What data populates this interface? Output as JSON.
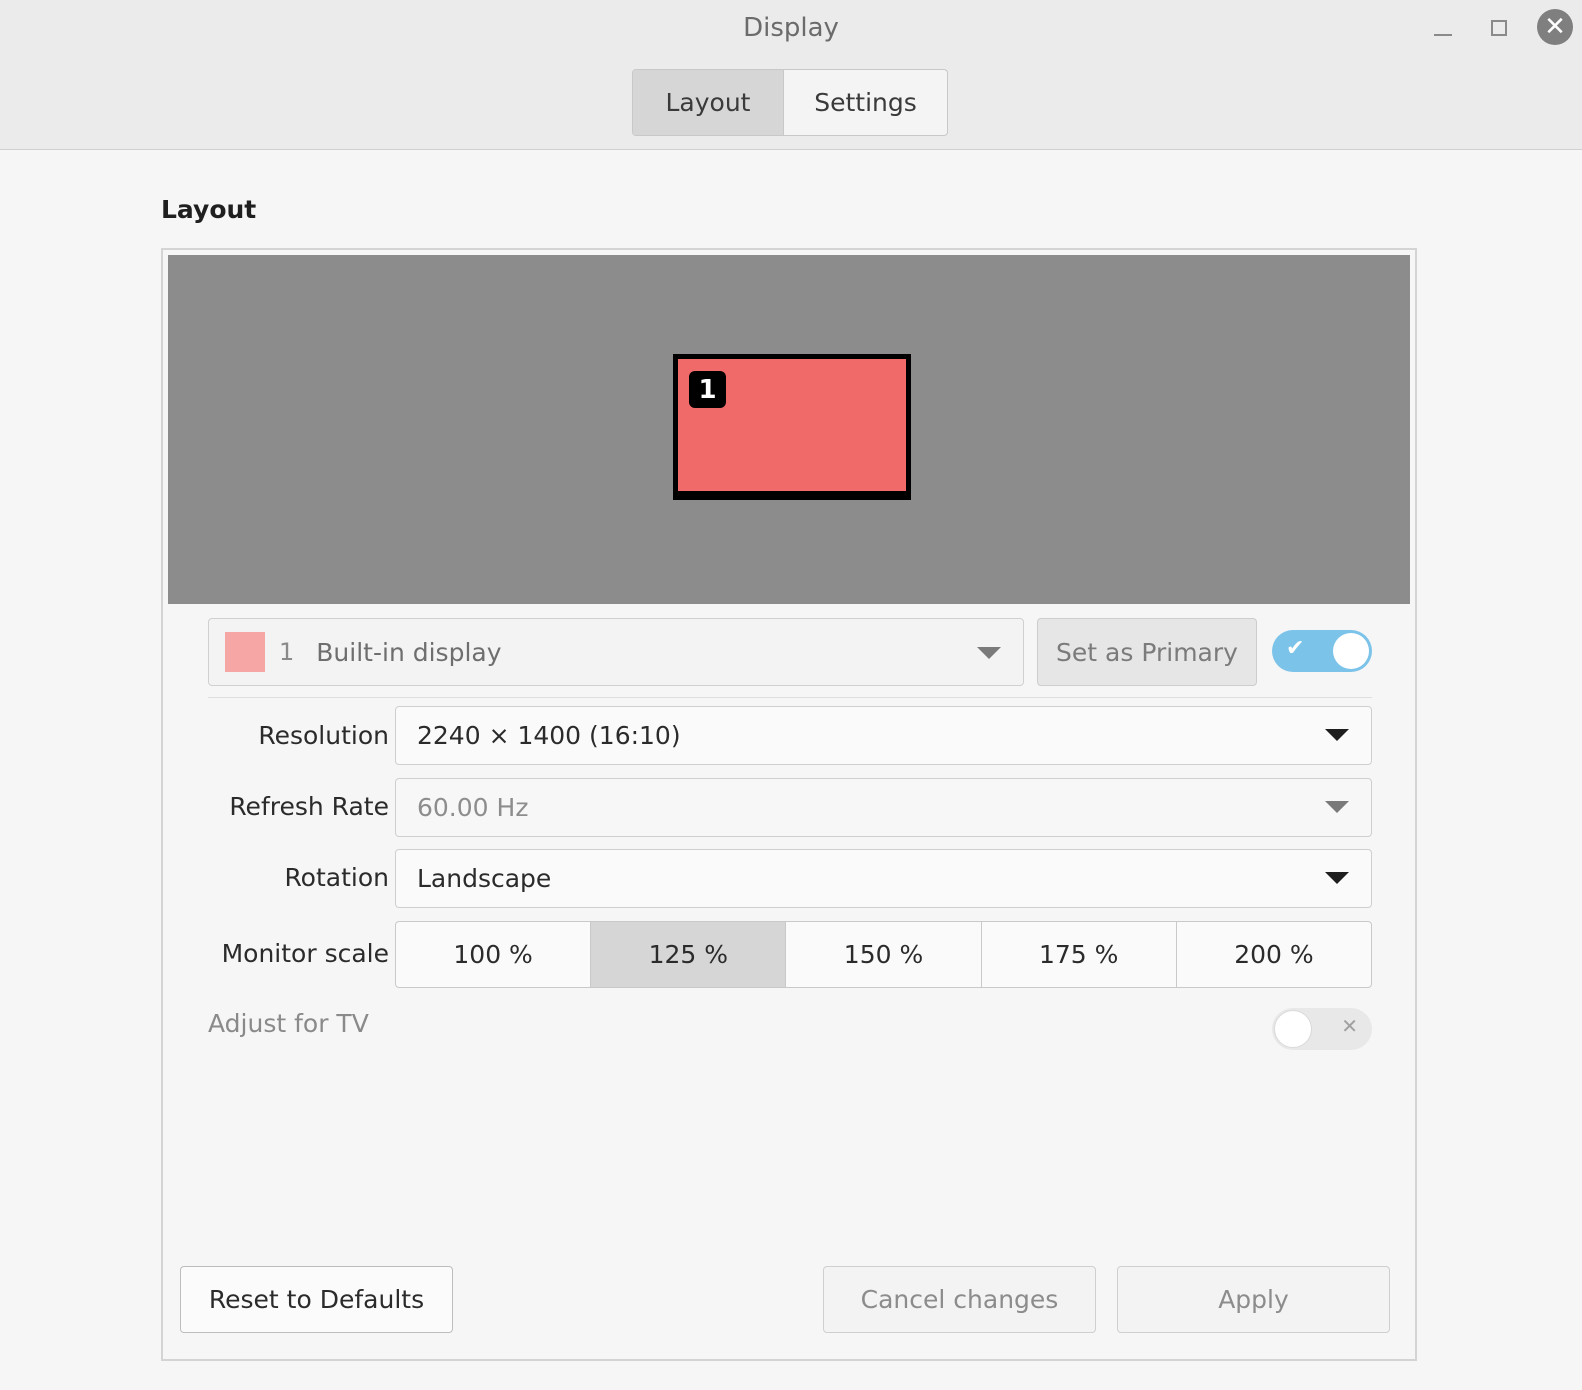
{
  "window": {
    "title": "Display",
    "close_glyph": "✕"
  },
  "tabs": [
    {
      "label": "Layout",
      "active": true
    },
    {
      "label": "Settings",
      "active": false
    }
  ],
  "section_title": "Layout",
  "preview": {
    "monitor_number": "1",
    "monitor_color": "#f06a6a"
  },
  "display_selector": {
    "number": "1",
    "name": "Built-in display",
    "swatch_color": "#f7a6a6"
  },
  "set_primary_label": "Set as Primary",
  "enabled_toggle": {
    "on": true,
    "glyph": "✔"
  },
  "settings": {
    "resolution": {
      "label": "Resolution",
      "value": "2240 × 1400 (16:10)"
    },
    "refresh_rate": {
      "label": "Refresh Rate",
      "value": "60.00 Hz"
    },
    "rotation": {
      "label": "Rotation",
      "value": "Landscape"
    },
    "monitor_scale": {
      "label": "Monitor scale",
      "options": [
        "100 %",
        "125 %",
        "150 %",
        "175 %",
        "200 %"
      ],
      "selected": "125 %"
    },
    "adjust_tv": {
      "label": "Adjust for TV",
      "on": false,
      "glyph": "✕"
    }
  },
  "footer": {
    "reset_label": "Reset to Defaults",
    "cancel_label": "Cancel changes",
    "apply_label": "Apply"
  }
}
